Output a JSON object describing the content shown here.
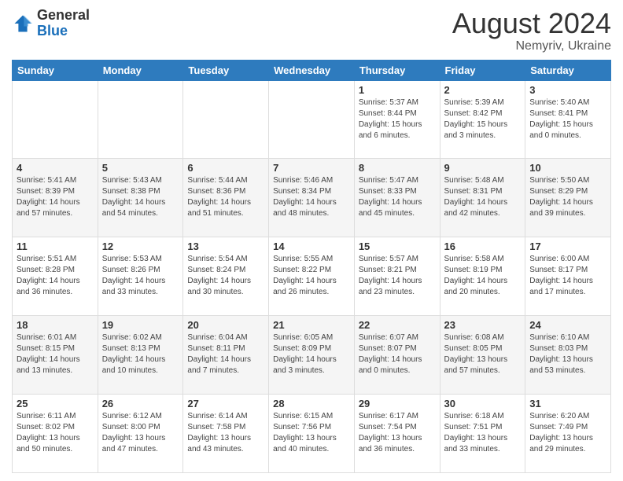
{
  "logo": {
    "line1": "General",
    "line2": "Blue"
  },
  "title": "August 2024",
  "subtitle": "Nemyriv, Ukraine",
  "days_header": [
    "Sunday",
    "Monday",
    "Tuesday",
    "Wednesday",
    "Thursday",
    "Friday",
    "Saturday"
  ],
  "weeks": [
    [
      {
        "day": "",
        "info": ""
      },
      {
        "day": "",
        "info": ""
      },
      {
        "day": "",
        "info": ""
      },
      {
        "day": "",
        "info": ""
      },
      {
        "day": "1",
        "info": "Sunrise: 5:37 AM\nSunset: 8:44 PM\nDaylight: 15 hours\nand 6 minutes."
      },
      {
        "day": "2",
        "info": "Sunrise: 5:39 AM\nSunset: 8:42 PM\nDaylight: 15 hours\nand 3 minutes."
      },
      {
        "day": "3",
        "info": "Sunrise: 5:40 AM\nSunset: 8:41 PM\nDaylight: 15 hours\nand 0 minutes."
      }
    ],
    [
      {
        "day": "4",
        "info": "Sunrise: 5:41 AM\nSunset: 8:39 PM\nDaylight: 14 hours\nand 57 minutes."
      },
      {
        "day": "5",
        "info": "Sunrise: 5:43 AM\nSunset: 8:38 PM\nDaylight: 14 hours\nand 54 minutes."
      },
      {
        "day": "6",
        "info": "Sunrise: 5:44 AM\nSunset: 8:36 PM\nDaylight: 14 hours\nand 51 minutes."
      },
      {
        "day": "7",
        "info": "Sunrise: 5:46 AM\nSunset: 8:34 PM\nDaylight: 14 hours\nand 48 minutes."
      },
      {
        "day": "8",
        "info": "Sunrise: 5:47 AM\nSunset: 8:33 PM\nDaylight: 14 hours\nand 45 minutes."
      },
      {
        "day": "9",
        "info": "Sunrise: 5:48 AM\nSunset: 8:31 PM\nDaylight: 14 hours\nand 42 minutes."
      },
      {
        "day": "10",
        "info": "Sunrise: 5:50 AM\nSunset: 8:29 PM\nDaylight: 14 hours\nand 39 minutes."
      }
    ],
    [
      {
        "day": "11",
        "info": "Sunrise: 5:51 AM\nSunset: 8:28 PM\nDaylight: 14 hours\nand 36 minutes."
      },
      {
        "day": "12",
        "info": "Sunrise: 5:53 AM\nSunset: 8:26 PM\nDaylight: 14 hours\nand 33 minutes."
      },
      {
        "day": "13",
        "info": "Sunrise: 5:54 AM\nSunset: 8:24 PM\nDaylight: 14 hours\nand 30 minutes."
      },
      {
        "day": "14",
        "info": "Sunrise: 5:55 AM\nSunset: 8:22 PM\nDaylight: 14 hours\nand 26 minutes."
      },
      {
        "day": "15",
        "info": "Sunrise: 5:57 AM\nSunset: 8:21 PM\nDaylight: 14 hours\nand 23 minutes."
      },
      {
        "day": "16",
        "info": "Sunrise: 5:58 AM\nSunset: 8:19 PM\nDaylight: 14 hours\nand 20 minutes."
      },
      {
        "day": "17",
        "info": "Sunrise: 6:00 AM\nSunset: 8:17 PM\nDaylight: 14 hours\nand 17 minutes."
      }
    ],
    [
      {
        "day": "18",
        "info": "Sunrise: 6:01 AM\nSunset: 8:15 PM\nDaylight: 14 hours\nand 13 minutes."
      },
      {
        "day": "19",
        "info": "Sunrise: 6:02 AM\nSunset: 8:13 PM\nDaylight: 14 hours\nand 10 minutes."
      },
      {
        "day": "20",
        "info": "Sunrise: 6:04 AM\nSunset: 8:11 PM\nDaylight: 14 hours\nand 7 minutes."
      },
      {
        "day": "21",
        "info": "Sunrise: 6:05 AM\nSunset: 8:09 PM\nDaylight: 14 hours\nand 3 minutes."
      },
      {
        "day": "22",
        "info": "Sunrise: 6:07 AM\nSunset: 8:07 PM\nDaylight: 14 hours\nand 0 minutes."
      },
      {
        "day": "23",
        "info": "Sunrise: 6:08 AM\nSunset: 8:05 PM\nDaylight: 13 hours\nand 57 minutes."
      },
      {
        "day": "24",
        "info": "Sunrise: 6:10 AM\nSunset: 8:03 PM\nDaylight: 13 hours\nand 53 minutes."
      }
    ],
    [
      {
        "day": "25",
        "info": "Sunrise: 6:11 AM\nSunset: 8:02 PM\nDaylight: 13 hours\nand 50 minutes."
      },
      {
        "day": "26",
        "info": "Sunrise: 6:12 AM\nSunset: 8:00 PM\nDaylight: 13 hours\nand 47 minutes."
      },
      {
        "day": "27",
        "info": "Sunrise: 6:14 AM\nSunset: 7:58 PM\nDaylight: 13 hours\nand 43 minutes."
      },
      {
        "day": "28",
        "info": "Sunrise: 6:15 AM\nSunset: 7:56 PM\nDaylight: 13 hours\nand 40 minutes."
      },
      {
        "day": "29",
        "info": "Sunrise: 6:17 AM\nSunset: 7:54 PM\nDaylight: 13 hours\nand 36 minutes."
      },
      {
        "day": "30",
        "info": "Sunrise: 6:18 AM\nSunset: 7:51 PM\nDaylight: 13 hours\nand 33 minutes."
      },
      {
        "day": "31",
        "info": "Sunrise: 6:20 AM\nSunset: 7:49 PM\nDaylight: 13 hours\nand 29 minutes."
      }
    ]
  ]
}
